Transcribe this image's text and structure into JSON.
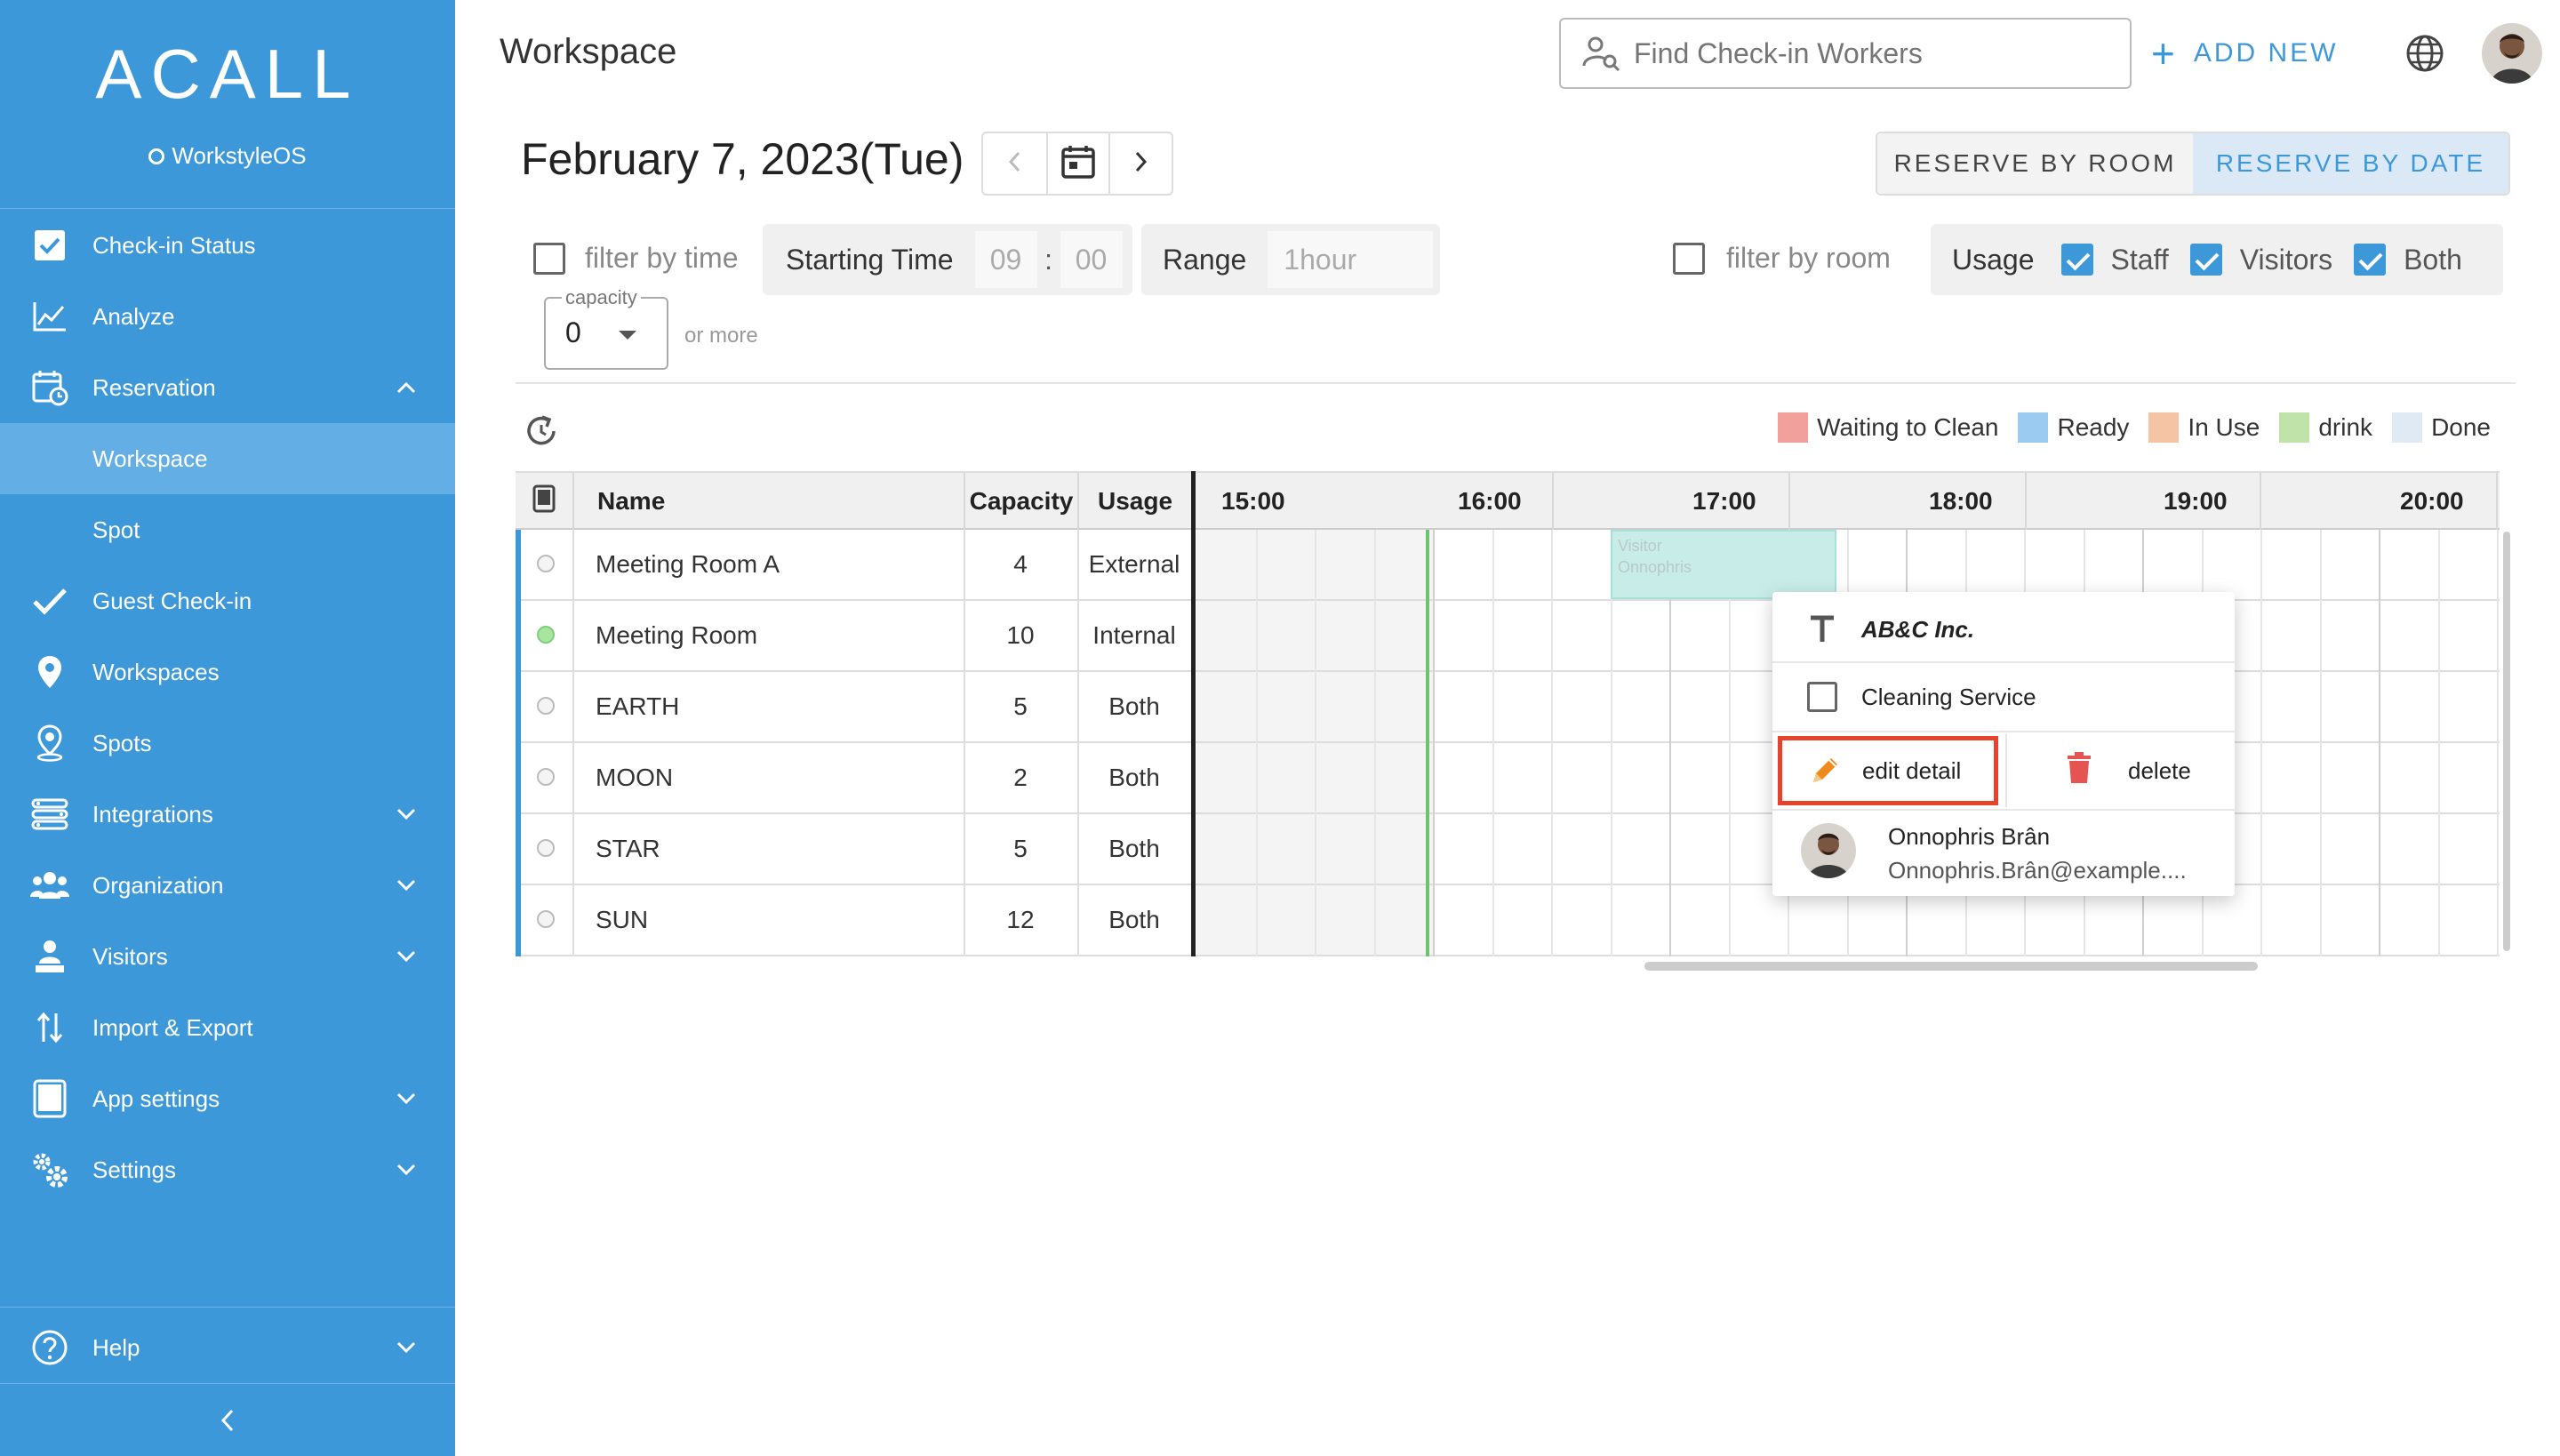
{
  "sidebar": {
    "logo": "ACALL",
    "product": "WorkstyleOS",
    "items": [
      {
        "label": "Check-in Status"
      },
      {
        "label": "Analyze"
      },
      {
        "label": "Reservation"
      },
      {
        "label": "Workspace"
      },
      {
        "label": "Spot"
      },
      {
        "label": "Guest Check-in"
      },
      {
        "label": "Workspaces"
      },
      {
        "label": "Spots"
      },
      {
        "label": "Integrations"
      },
      {
        "label": "Organization"
      },
      {
        "label": "Visitors"
      },
      {
        "label": "Import & Export"
      },
      {
        "label": "App settings"
      },
      {
        "label": "Settings"
      },
      {
        "label": "Help"
      }
    ]
  },
  "header": {
    "title": "Workspace",
    "search_placeholder": "Find Check-in Workers",
    "add_new": "ADD NEW"
  },
  "date": {
    "title": "February 7, 2023(Tue)"
  },
  "reserve": {
    "by_room": "RESERVE BY ROOM",
    "by_date": "RESERVE BY DATE",
    "active": "by_date"
  },
  "filters": {
    "filter_by_time": "filter by time",
    "starting_time_label": "Starting Time",
    "hour": "09",
    "colon": ":",
    "minute": "00",
    "range_label": "Range",
    "range_value": "1hour",
    "capacity_label": "capacity",
    "capacity_value": "0",
    "or_more": "or more",
    "filter_by_room": "filter by room",
    "usage_label": "Usage",
    "usage_options": [
      {
        "label": "Staff",
        "checked": true
      },
      {
        "label": "Visitors",
        "checked": true
      },
      {
        "label": "Both",
        "checked": true
      }
    ]
  },
  "legend": [
    {
      "label": "Waiting to Clean",
      "color": "#f2a09b"
    },
    {
      "label": "Ready",
      "color": "#9ccbf2"
    },
    {
      "label": "In Use",
      "color": "#f5c4a5"
    },
    {
      "label": "drink",
      "color": "#bfe3a8"
    },
    {
      "label": "Done",
      "color": "#dfeaf5"
    }
  ],
  "table": {
    "headers": {
      "name": "Name",
      "capacity": "Capacity",
      "usage": "Usage"
    },
    "hours": [
      "15:00",
      "16:00",
      "17:00",
      "18:00",
      "19:00",
      "20:00"
    ],
    "rows": [
      {
        "name": "Meeting Room A",
        "capacity": "4",
        "usage": "External",
        "status": "idle"
      },
      {
        "name": "Meeting Room",
        "capacity": "10",
        "usage": "Internal",
        "status": "active"
      },
      {
        "name": "EARTH",
        "capacity": "5",
        "usage": "Both",
        "status": "idle"
      },
      {
        "name": "MOON",
        "capacity": "2",
        "usage": "Both",
        "status": "idle"
      },
      {
        "name": "STAR",
        "capacity": "5",
        "usage": "Both",
        "status": "idle"
      },
      {
        "name": "SUN",
        "capacity": "12",
        "usage": "Both",
        "status": "idle"
      }
    ],
    "booking": {
      "line1": "Visitor",
      "line2": "Onnophris"
    }
  },
  "popup": {
    "company": "AB&C Inc.",
    "cleaning": "Cleaning Service",
    "edit": "edit detail",
    "delete": "delete",
    "user_name": "Onnophris Brân",
    "user_email": "Onnophris.Brân@example...."
  },
  "colors": {
    "sidebar": "#3d98da",
    "accent": "#3d98da",
    "highlight": "#e8412c"
  }
}
